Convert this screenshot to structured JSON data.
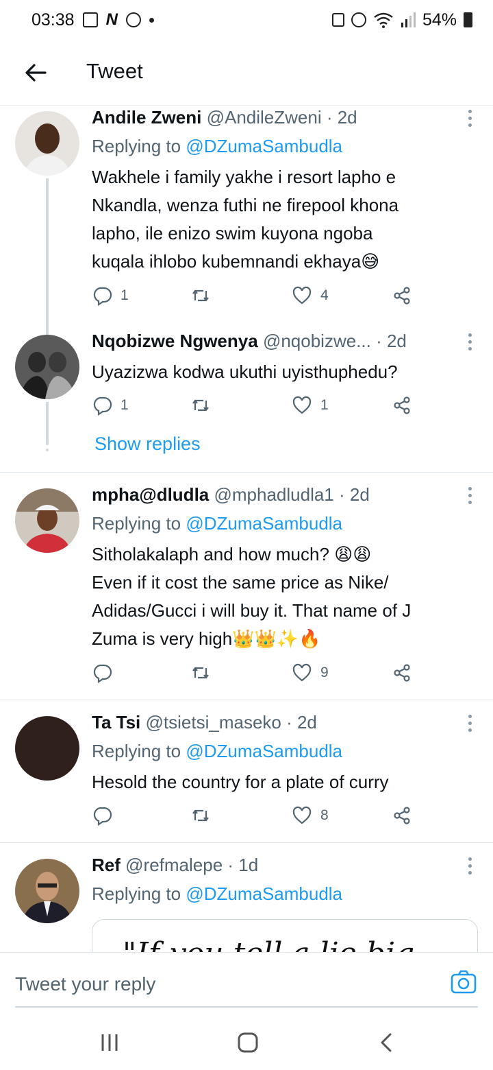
{
  "status_bar": {
    "time": "03:38",
    "battery": "54%"
  },
  "header": {
    "title": "Tweet"
  },
  "tweets": [
    {
      "name": "Andile Zweni",
      "handle": "@AndileZweni · 2d",
      "replying_prefix": "Replying to",
      "replying_to": "@DZumaSambudla",
      "body": "Wakhele i family yakhe i resort lapho e\nNkandla, wenza futhi ne firepool khona\nlapho, ile enizo swim kuyona ngoba\nkuqala ihlobo kubemnandi ekhaya😅",
      "replies": "1",
      "retweets": "",
      "likes": "4"
    },
    {
      "name": "Nqobizwe Ngwenya",
      "handle": "@nqobizwe... · 2d",
      "body": "Uyazizwa kodwa ukuthi uyisthuphedu?",
      "replies": "1",
      "retweets": "",
      "likes": "1"
    },
    {
      "name": "mpha@dludla",
      "handle": "@mphadludla1 · 2d",
      "replying_prefix": "Replying to",
      "replying_to": "@DZumaSambudla",
      "body": "Sitholakalaph and how much? 😩😩\nEven if it cost the same price as Nike/\nAdidas/Gucci i will buy  it. That name of J\nZuma is very high👑👑✨🔥",
      "replies": "",
      "retweets": "",
      "likes": "9"
    },
    {
      "name": "Ta Tsi",
      "handle": "@tsietsi_maseko · 2d",
      "replying_prefix": "Replying to",
      "replying_to": "@DZumaSambudla",
      "body": "Hesold the country for a plate of curry",
      "replies": "",
      "retweets": "",
      "likes": "8"
    },
    {
      "name": "Ref",
      "handle": "@refmalepe · 1d",
      "replying_prefix": "Replying to",
      "replying_to": "@DZumaSambudla",
      "quote_text": "\"If you tell a lie big"
    }
  ],
  "show_replies": "Show replies",
  "reply_bar": {
    "placeholder": "Tweet your reply"
  },
  "colors": {
    "accent": "#1d9bf0",
    "secondary_text": "#536471",
    "divider": "#e1e8ed"
  },
  "icons": [
    "back-arrow-icon",
    "reply-icon",
    "retweet-icon",
    "like-icon",
    "share-icon",
    "more-icon",
    "camera-icon",
    "recents-icon",
    "home-icon",
    "back-icon"
  ]
}
